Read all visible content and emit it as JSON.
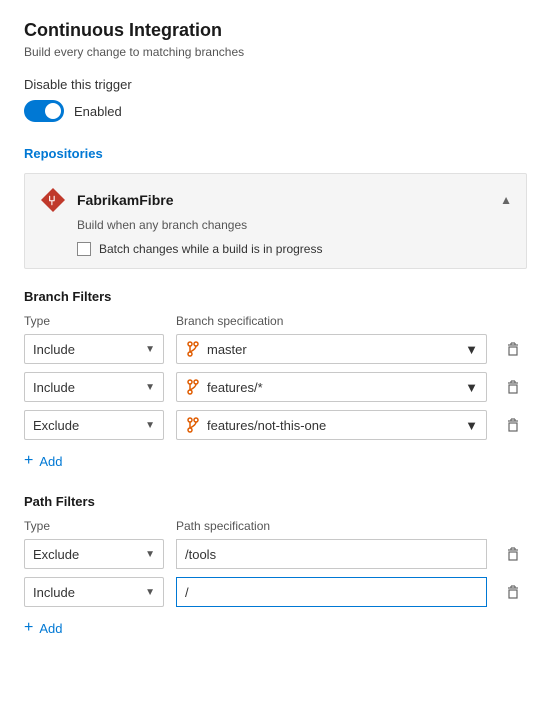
{
  "page": {
    "title": "Continuous Integration",
    "subtitle": "Build every change to matching branches"
  },
  "trigger": {
    "disable_label": "Disable this trigger",
    "toggle_state": "Enabled",
    "enabled": true
  },
  "repositories": {
    "section_label": "Repositories",
    "repo": {
      "name": "FabrikamFibre",
      "description": "Build when any branch changes",
      "batch_label": "Batch changes while a build is in progress"
    }
  },
  "branch_filters": {
    "section_label": "Branch Filters",
    "type_col": "Type",
    "spec_col": "Branch specification",
    "rows": [
      {
        "type": "Include",
        "spec": "master"
      },
      {
        "type": "Include",
        "spec": "features/*"
      },
      {
        "type": "Exclude",
        "spec": "features/not-this-one"
      }
    ],
    "add_label": "Add"
  },
  "path_filters": {
    "section_label": "Path Filters",
    "type_col": "Type",
    "spec_col": "Path specification",
    "rows": [
      {
        "type": "Exclude",
        "spec": "/tools",
        "is_input": false
      },
      {
        "type": "Include",
        "spec": "/",
        "is_input": true
      }
    ],
    "add_label": "Add"
  },
  "icons": {
    "chevron_up": "∧",
    "chevron_down": "∨",
    "delete": "🗑",
    "add": "+",
    "git": "⑂"
  }
}
